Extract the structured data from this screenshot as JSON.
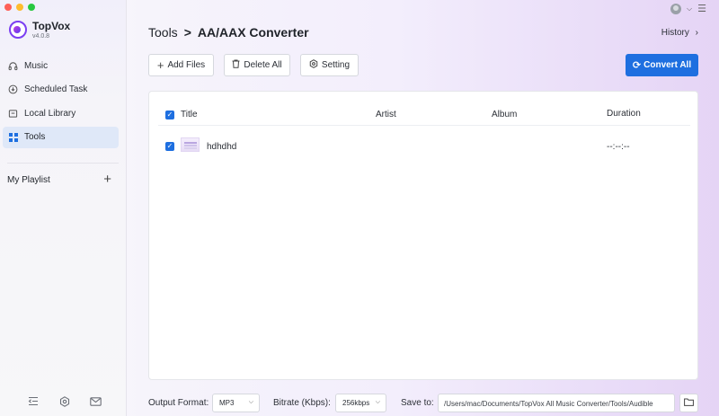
{
  "app": {
    "name": "TopVox",
    "version": "v4.0.8"
  },
  "sidebar": {
    "items": [
      {
        "label": "Music",
        "icon": "headphones-icon"
      },
      {
        "label": "Scheduled Task",
        "icon": "download-icon"
      },
      {
        "label": "Local Library",
        "icon": "library-icon"
      },
      {
        "label": "Tools",
        "icon": "grid-icon",
        "active": true
      }
    ],
    "playlist_label": "My Playlist",
    "playlist_add": "+",
    "bottom_icons": [
      "collapse-icon",
      "settings-icon",
      "mail-icon"
    ]
  },
  "header": {
    "breadcrumb_root": "Tools",
    "breadcrumb_sep": ">",
    "breadcrumb_current": "AA/AAX Converter",
    "history_label": "History"
  },
  "toolbar": {
    "add_files": "Add Files",
    "delete_all": "Delete All",
    "setting": "Setting",
    "convert_all": "Convert All"
  },
  "table": {
    "columns": {
      "title": "Title",
      "artist": "Artist",
      "album": "Album",
      "duration": "Duration"
    },
    "rows": [
      {
        "title": "hdhdhd",
        "artist": "",
        "album": "",
        "duration": "--:--:--",
        "checked": true
      }
    ]
  },
  "footer": {
    "output_format_label": "Output Format:",
    "output_format_value": "MP3",
    "bitrate_label": "Bitrate (Kbps):",
    "bitrate_value": "256kbps",
    "save_to_label": "Save to:",
    "save_to_path": "/Users/mac/Documents/TopVox All Music Converter/Tools/Audible"
  },
  "colors": {
    "accent": "#1e6fe0",
    "active_nav_bg": "#dfe8f8",
    "traffic_red": "#fe5f57",
    "traffic_yellow": "#febc2e",
    "traffic_green": "#28c840"
  }
}
